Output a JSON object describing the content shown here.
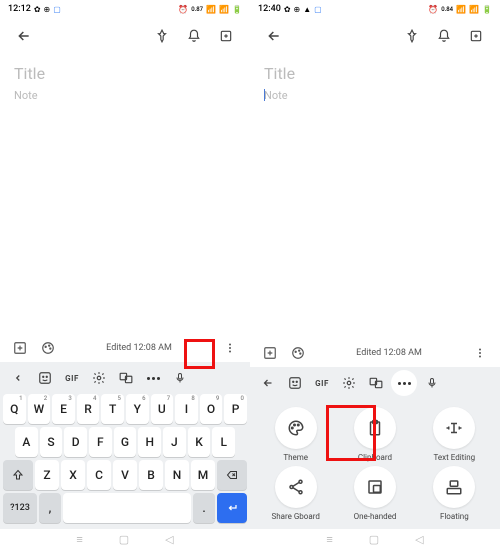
{
  "left": {
    "status_time": "12:12",
    "status_right": "0.87",
    "title_placeholder": "Title",
    "note_placeholder": "Note",
    "edited_label": "Edited 12:08 AM",
    "gif_label": "GIF",
    "row1": [
      "Q",
      "W",
      "E",
      "R",
      "T",
      "Y",
      "U",
      "I",
      "O",
      "P"
    ],
    "row1num": [
      "1",
      "2",
      "3",
      "4",
      "5",
      "6",
      "7",
      "8",
      "9",
      "0"
    ],
    "row2": [
      "A",
      "S",
      "D",
      "F",
      "G",
      "H",
      "J",
      "K",
      "L"
    ],
    "row3": [
      "Z",
      "X",
      "C",
      "V",
      "B",
      "N",
      "M"
    ],
    "key_123": "?123",
    "key_comma": ",",
    "key_period": "."
  },
  "right": {
    "status_time": "12:40",
    "status_right": "0.84",
    "title_placeholder": "Title",
    "note_placeholder": "Note",
    "edited_label": "Edited 12:08 AM",
    "gif_label": "GIF",
    "options": [
      {
        "label": "Theme",
        "icon": "palette"
      },
      {
        "label": "Clipboard",
        "icon": "clipboard"
      },
      {
        "label": "Text Editing",
        "icon": "textedit"
      },
      {
        "label": "Share Gboard",
        "icon": "share"
      },
      {
        "label": "One-handed",
        "icon": "onehand"
      },
      {
        "label": "Floating",
        "icon": "floating"
      }
    ]
  }
}
